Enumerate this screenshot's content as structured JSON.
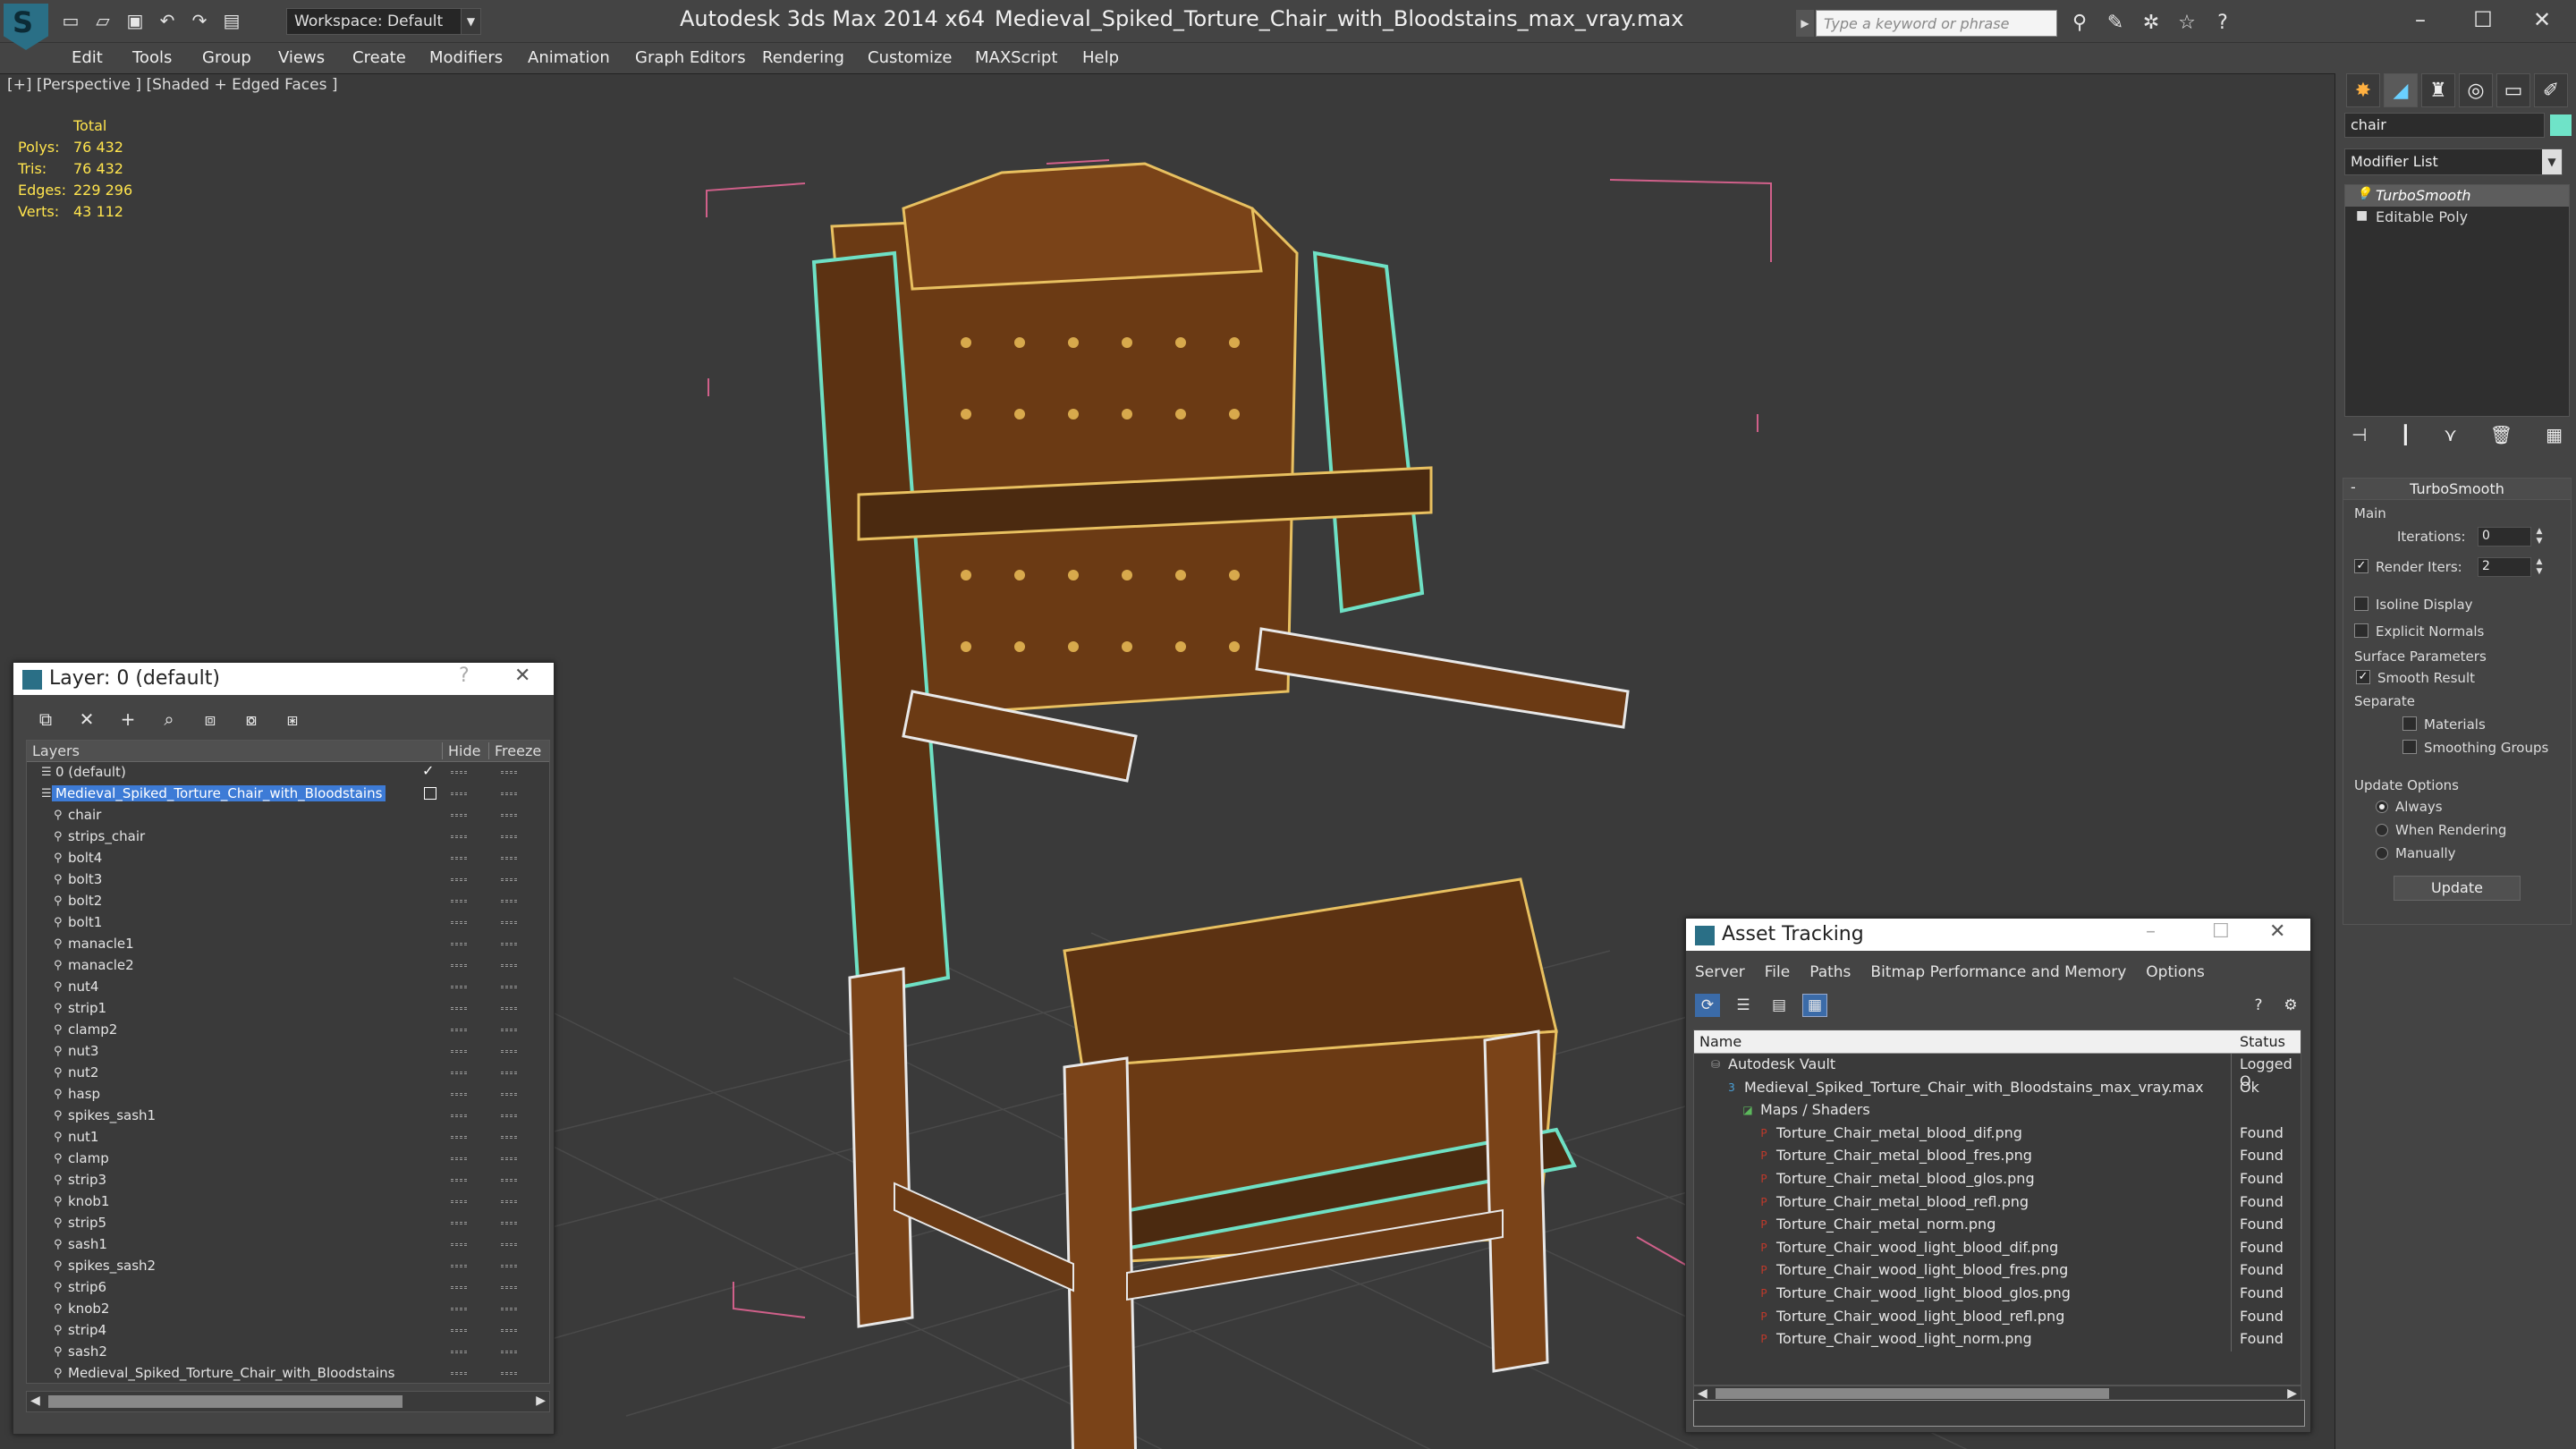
{
  "app": {
    "title": "Autodesk 3ds Max  2014 x64",
    "file": "Medieval_Spiked_Torture_Chair_with_Bloodstains_max_vray.max",
    "workspace": "Workspace: Default",
    "search_placeholder": "Type a keyword or phrase"
  },
  "menu": [
    "Edit",
    "Tools",
    "Group",
    "Views",
    "Create",
    "Modifiers",
    "Animation",
    "Graph Editors",
    "Rendering",
    "Customize",
    "MAXScript",
    "Help"
  ],
  "viewport": {
    "label": "[+] [Perspective ] [Shaded + Edged Faces ]",
    "stats": {
      "header": "Total",
      "rows": [
        {
          "k": "Polys:",
          "v": "76 432"
        },
        {
          "k": "Tris:",
          "v": "76 432"
        },
        {
          "k": "Edges:",
          "v": "229 296"
        },
        {
          "k": "Verts:",
          "v": "43 112"
        }
      ]
    }
  },
  "command_panel": {
    "object_name": "chair",
    "object_color": "#6fe3c8",
    "modifier_list": "Modifier List",
    "stack": [
      "TurboSmooth",
      "Editable Poly"
    ],
    "rollout": {
      "title": "TurboSmooth",
      "main": "Main",
      "iterations_label": "Iterations:",
      "iterations": "0",
      "render_iters_label": "Render Iters:",
      "render_iters": "2",
      "isoline": "Isoline Display",
      "explicit": "Explicit Normals",
      "surface": "Surface Parameters",
      "smooth_result": "Smooth Result",
      "separate": "Separate",
      "materials": "Materials",
      "smoothing_groups": "Smoothing Groups",
      "update_options": "Update Options",
      "always": "Always",
      "when_rendering": "When Rendering",
      "manually": "Manually",
      "update": "Update"
    }
  },
  "layer_dialog": {
    "title": "Layer: 0 (default)",
    "help": "?",
    "columns": {
      "layers": "Layers",
      "hide": "Hide",
      "freeze": "Freeze"
    },
    "rows": [
      {
        "name": "0 (default)",
        "level": 1,
        "type": "layer",
        "check": "✓"
      },
      {
        "name": "Medieval_Spiked_Torture_Chair_with_Bloodstains",
        "level": 1,
        "type": "layer",
        "selected": true
      },
      {
        "name": "chair",
        "level": 2
      },
      {
        "name": "strips_chair",
        "level": 2
      },
      {
        "name": "bolt4",
        "level": 2
      },
      {
        "name": "bolt3",
        "level": 2
      },
      {
        "name": "bolt2",
        "level": 2
      },
      {
        "name": "bolt1",
        "level": 2
      },
      {
        "name": "manacle1",
        "level": 2
      },
      {
        "name": "manacle2",
        "level": 2
      },
      {
        "name": "nut4",
        "level": 2
      },
      {
        "name": "strip1",
        "level": 2
      },
      {
        "name": "clamp2",
        "level": 2
      },
      {
        "name": "nut3",
        "level": 2
      },
      {
        "name": "nut2",
        "level": 2
      },
      {
        "name": "hasp",
        "level": 2
      },
      {
        "name": "spikes_sash1",
        "level": 2
      },
      {
        "name": "nut1",
        "level": 2
      },
      {
        "name": "clamp",
        "level": 2
      },
      {
        "name": "strip3",
        "level": 2
      },
      {
        "name": "knob1",
        "level": 2
      },
      {
        "name": "strip5",
        "level": 2
      },
      {
        "name": "sash1",
        "level": 2
      },
      {
        "name": "spikes_sash2",
        "level": 2
      },
      {
        "name": "strip6",
        "level": 2
      },
      {
        "name": "knob2",
        "level": 2
      },
      {
        "name": "strip4",
        "level": 2
      },
      {
        "name": "sash2",
        "level": 2
      },
      {
        "name": "Medieval_Spiked_Torture_Chair_with_Bloodstains",
        "level": 2
      }
    ]
  },
  "asset_dialog": {
    "title": "Asset Tracking",
    "menu": [
      "Server",
      "File",
      "Paths",
      "Bitmap Performance and Memory",
      "Options"
    ],
    "columns": {
      "name": "Name",
      "status": "Status"
    },
    "rows": [
      {
        "name": "Autodesk Vault",
        "status": "Logged O",
        "level": 0,
        "icon": "vault"
      },
      {
        "name": "Medieval_Spiked_Torture_Chair_with_Bloodstains_max_vray.max",
        "status": "Ok",
        "level": 1,
        "icon": "max"
      },
      {
        "name": "Maps / Shaders",
        "status": "",
        "level": 2,
        "icon": "maps"
      },
      {
        "name": "Torture_Chair_metal_blood_dif.png",
        "status": "Found",
        "level": 3,
        "icon": "png"
      },
      {
        "name": "Torture_Chair_metal_blood_fres.png",
        "status": "Found",
        "level": 3,
        "icon": "png"
      },
      {
        "name": "Torture_Chair_metal_blood_glos.png",
        "status": "Found",
        "level": 3,
        "icon": "png"
      },
      {
        "name": "Torture_Chair_metal_blood_refl.png",
        "status": "Found",
        "level": 3,
        "icon": "png"
      },
      {
        "name": "Torture_Chair_metal_norm.png",
        "status": "Found",
        "level": 3,
        "icon": "png"
      },
      {
        "name": "Torture_Chair_wood_light_blood_dif.png",
        "status": "Found",
        "level": 3,
        "icon": "png"
      },
      {
        "name": "Torture_Chair_wood_light_blood_fres.png",
        "status": "Found",
        "level": 3,
        "icon": "png"
      },
      {
        "name": "Torture_Chair_wood_light_blood_glos.png",
        "status": "Found",
        "level": 3,
        "icon": "png"
      },
      {
        "name": "Torture_Chair_wood_light_blood_refl.png",
        "status": "Found",
        "level": 3,
        "icon": "png"
      },
      {
        "name": "Torture_Chair_wood_light_norm.png",
        "status": "Found",
        "level": 3,
        "icon": "png"
      }
    ]
  }
}
